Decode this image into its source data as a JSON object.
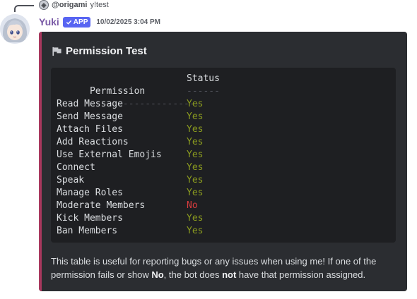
{
  "reply": {
    "author": "@origami",
    "text": "y!test"
  },
  "message": {
    "username": "Yuki",
    "badge": "APP",
    "timestamp": "10/02/2025 3:04 PM"
  },
  "embed": {
    "accent_color": "#a8385e",
    "title": "Permission Test",
    "icon": "flag-icon",
    "table": {
      "header_permission": "Permission",
      "header_status": "Status",
      "divider_permission": "--------------------",
      "divider_status": "------",
      "rows": [
        {
          "permission": "Read Message",
          "status": "Yes"
        },
        {
          "permission": "Send Message",
          "status": "Yes"
        },
        {
          "permission": "Attach Files",
          "status": "Yes"
        },
        {
          "permission": "Add Reactions",
          "status": "Yes"
        },
        {
          "permission": "Use External Emojis",
          "status": "Yes"
        },
        {
          "permission": "Connect",
          "status": "Yes"
        },
        {
          "permission": "Speak",
          "status": "Yes"
        },
        {
          "permission": "Manage Roles",
          "status": "Yes"
        },
        {
          "permission": "Moderate Members",
          "status": "No"
        },
        {
          "permission": "Kick Members",
          "status": "Yes"
        },
        {
          "permission": "Ban Members",
          "status": "Yes"
        }
      ]
    },
    "description": {
      "part1": "This table is useful for reporting bugs or any issues when using me! If one of the permission fails or show ",
      "bold1": "No",
      "part2": ", the bot does ",
      "bold2": "not",
      "part3": " have that permission assigned."
    }
  },
  "colors": {
    "yes": "#8a9a1f",
    "no": "#d83c3e"
  }
}
